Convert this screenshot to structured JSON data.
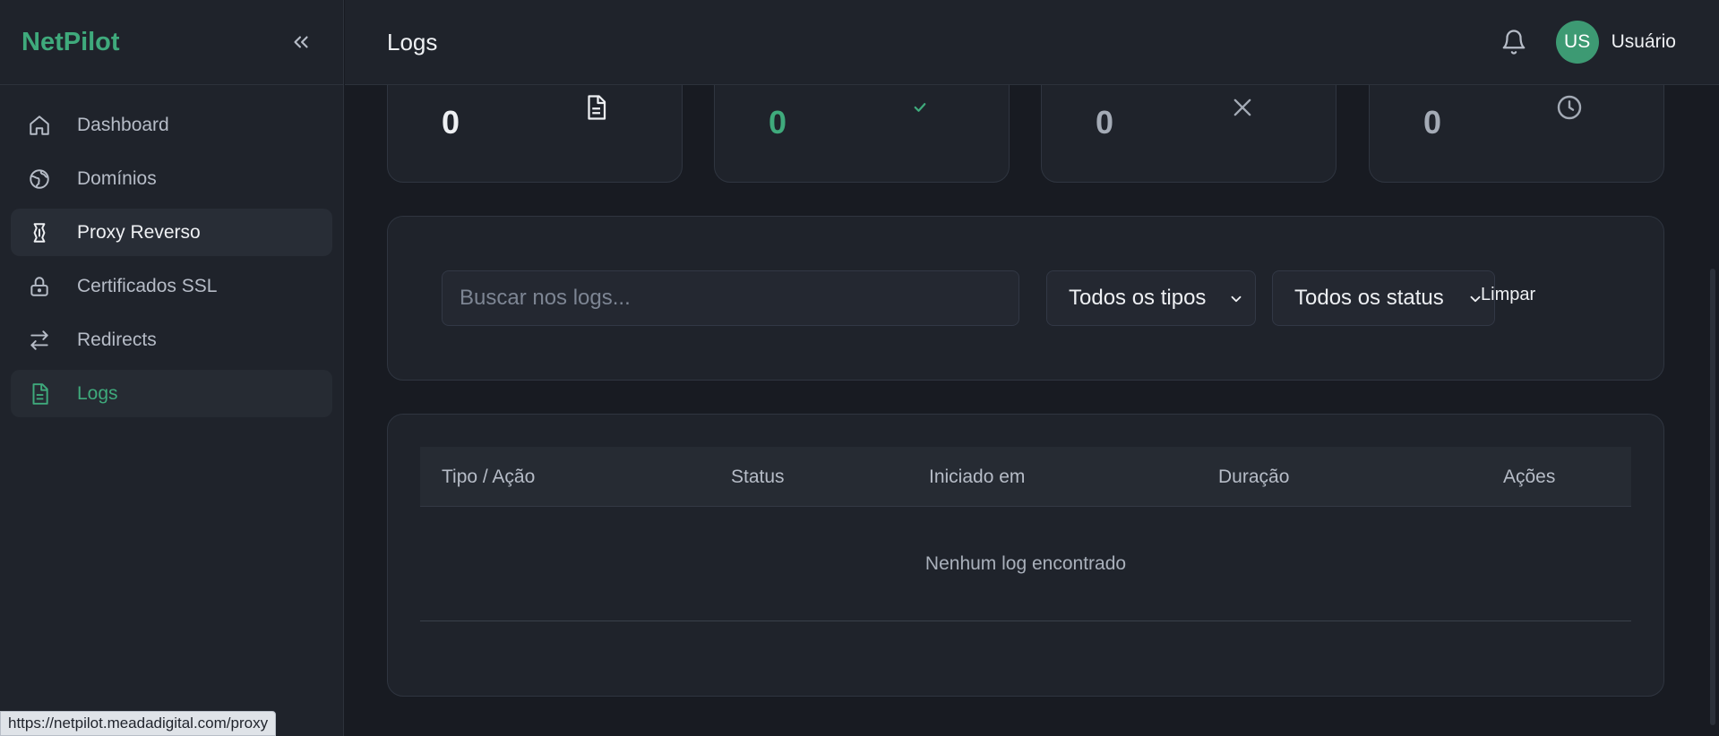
{
  "brand": {
    "name": "NetPilot"
  },
  "sidebar": {
    "items": [
      {
        "label": "Dashboard",
        "icon": "home-icon"
      },
      {
        "label": "Domínios",
        "icon": "globe-icon"
      },
      {
        "label": "Proxy Reverso",
        "icon": "proxy-icon"
      },
      {
        "label": "Certificados SSL",
        "icon": "lock-icon"
      },
      {
        "label": "Redirects",
        "icon": "arrows-icon"
      },
      {
        "label": "Logs",
        "icon": "document-icon"
      }
    ],
    "active": "Logs",
    "hovered": "Proxy Reverso"
  },
  "header": {
    "title": "Logs",
    "avatar_initials": "US",
    "user_name": "Usuário"
  },
  "stats": [
    {
      "value": "0",
      "icon": "document-icon",
      "color": "#eef0f3"
    },
    {
      "value": "0",
      "icon": "check-icon",
      "color": "#3faa7c"
    },
    {
      "value": "0",
      "icon": "x-icon",
      "color": "#a4abb6"
    },
    {
      "value": "0",
      "icon": "clock-icon",
      "color": "#a4abb6"
    }
  ],
  "filters": {
    "search_placeholder": "Buscar nos logs...",
    "type_select": "Todos os tipos",
    "status_select": "Todos os status",
    "clear_label": "Limpar"
  },
  "table": {
    "columns": [
      "Tipo / Ação",
      "Status",
      "Iniciado em",
      "Duração",
      "Ações"
    ],
    "empty_message": "Nenhum log encontrado"
  },
  "status_bar": {
    "url": "https://netpilot.meadadigital.com/proxy"
  },
  "colors": {
    "accent": "#3faa7c",
    "background": "#181b22",
    "panel": "#1f232b"
  }
}
